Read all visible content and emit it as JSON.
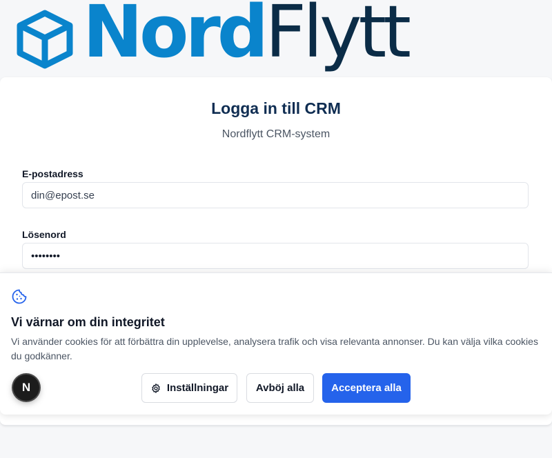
{
  "brand": {
    "name_part1": "Nord",
    "name_part2": "Flytt",
    "primary_color": "#0a84cc",
    "dark_color": "#0b2c47",
    "logo_icon": "cube-icon"
  },
  "login": {
    "title": "Logga in till CRM",
    "subtitle": "Nordflytt CRM-system",
    "email_label": "E-postadress",
    "email_placeholder": "din@epost.se",
    "password_label": "Lösenord",
    "password_value": "••••••••"
  },
  "cookie_banner": {
    "icon": "cookie-icon",
    "title": "Vi värnar om din integritet",
    "text": "Vi använder cookies för att förbättra din upplevelse, analysera trafik och visa relevanta annonser. Du kan välja vilka cookies du godkänner.",
    "settings_label": "Inställningar",
    "settings_icon": "gear-icon",
    "reject_label": "Avböj alla",
    "accept_label": "Acceptera alla",
    "accent_color": "#2563eb"
  },
  "dev_badge": {
    "label": "N"
  }
}
